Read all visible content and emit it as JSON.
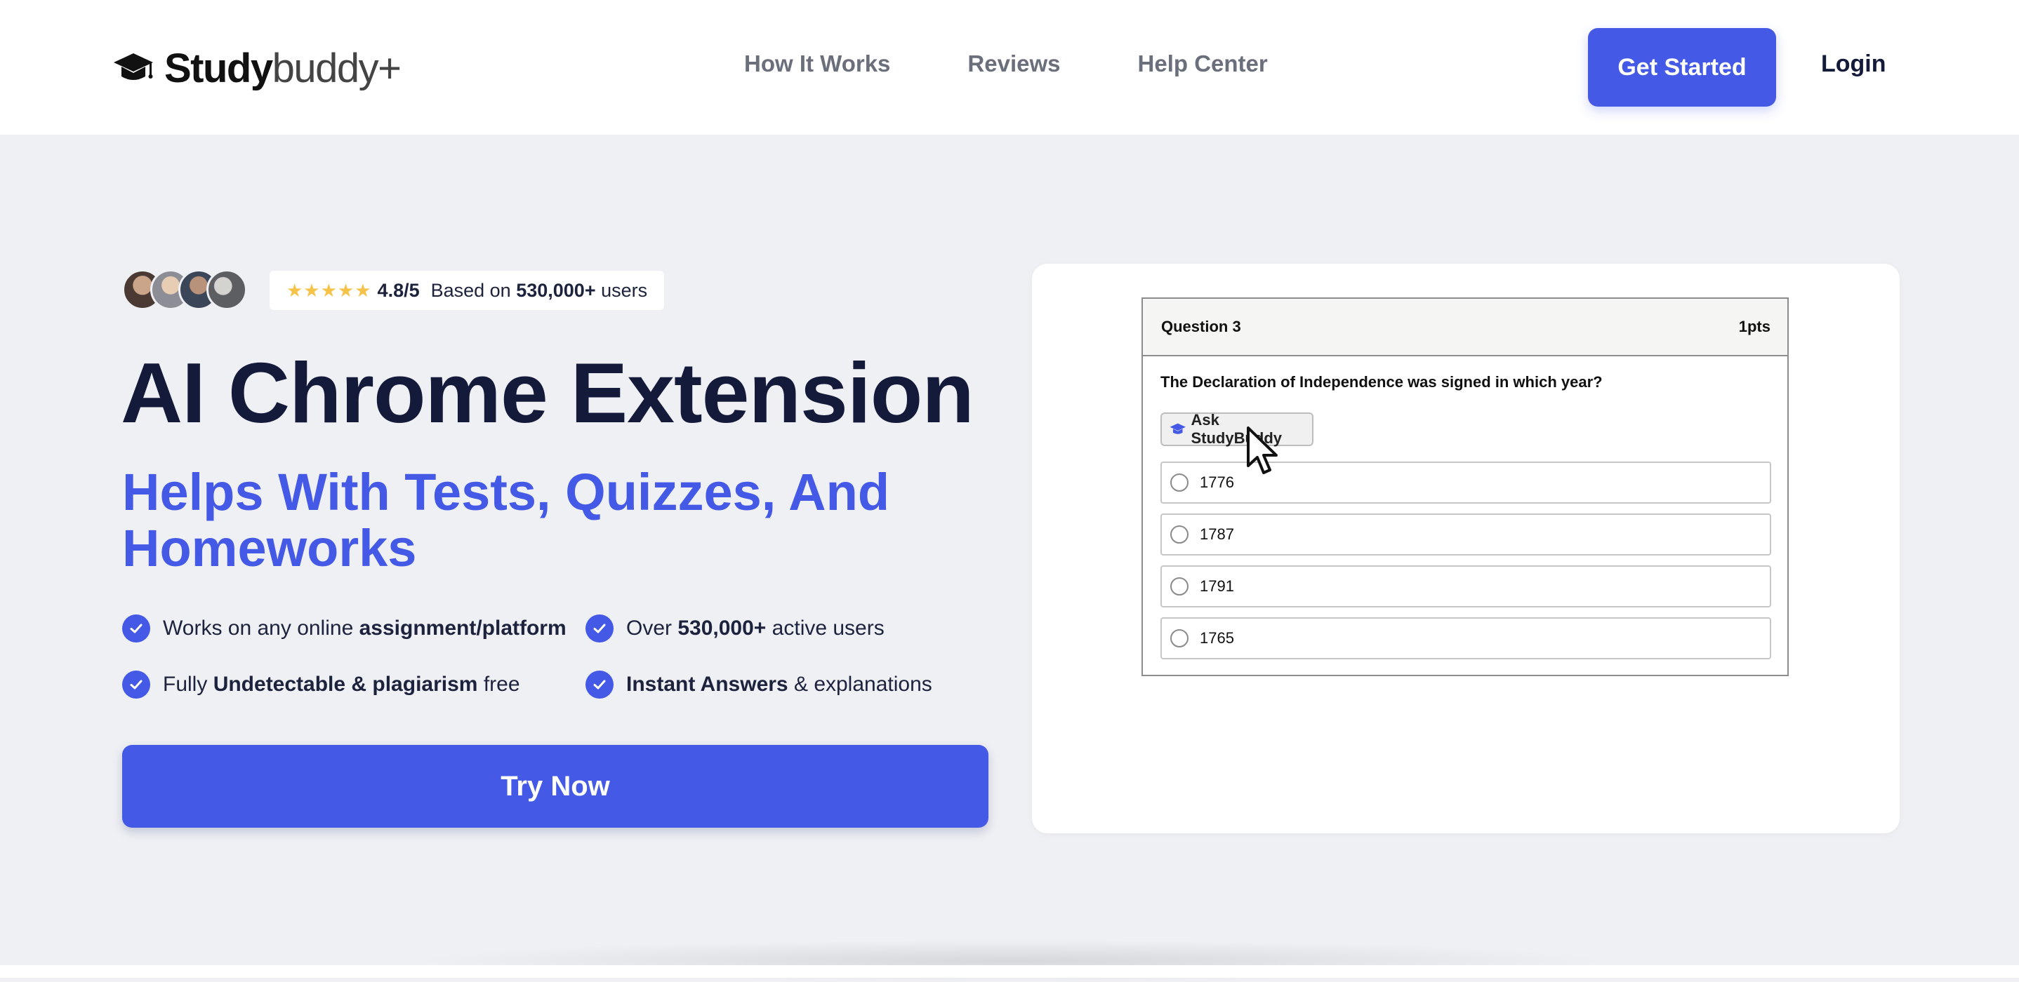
{
  "header": {
    "logo": {
      "word1": "Study",
      "word2": "buddy+"
    },
    "nav": [
      "How It Works",
      "Reviews",
      "Help Center"
    ],
    "get_started_label": "Get Started",
    "login_label": "Login"
  },
  "hero": {
    "rating": {
      "stars": "★★★★★",
      "value": "4.8/5",
      "text_prefix": "Based on",
      "count": "530,000+",
      "text_suffix": "users"
    },
    "title": "AI Chrome Extension",
    "subtitle": "Helps With Tests, Quizzes, And Homeworks",
    "features": [
      {
        "pre": "Works on any online",
        "bold": "assignment/platform",
        "post": ""
      },
      {
        "pre": "Over",
        "bold": "530,000+",
        "post": "active users"
      },
      {
        "pre": "Fully",
        "bold": "Undetectable & plagiarism",
        "post": "free"
      },
      {
        "pre": "",
        "bold": "Instant Answers",
        "post": "& explanations"
      }
    ],
    "cta_label": "Try Now"
  },
  "quiz": {
    "question_number": "Question 3",
    "points": "1pts",
    "question": "The Declaration of Independence was signed in which year?",
    "ask_label": "Ask StudyBuddy",
    "options": [
      "1776",
      "1787",
      "1791",
      "1765"
    ]
  },
  "colors": {
    "brand": "#4459e6",
    "navy": "#141a3a",
    "star": "#f5c34a",
    "page_bg": "#eff0f4"
  },
  "icons": {
    "logo": "graduation-cap-icon",
    "feature": "check-circle-icon",
    "pointer": "mouse-pointer-icon"
  }
}
